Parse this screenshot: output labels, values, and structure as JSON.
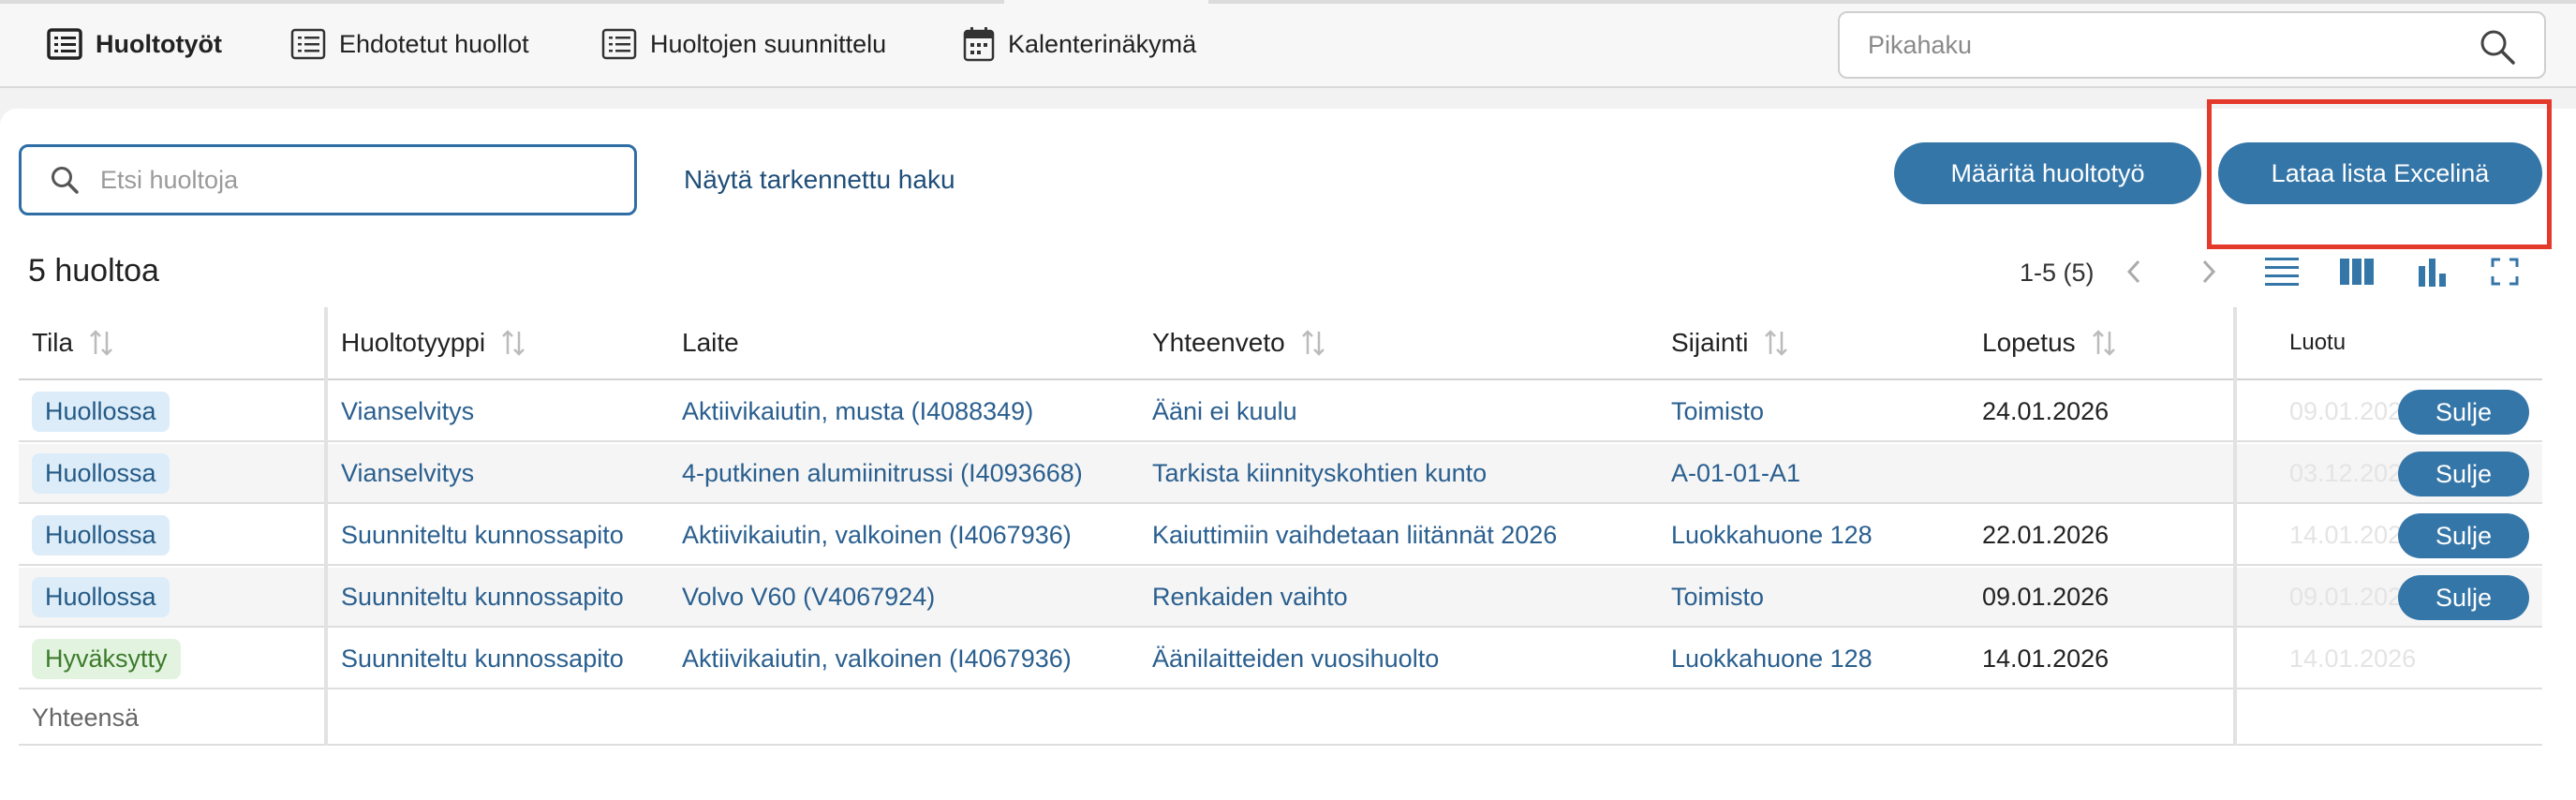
{
  "nav": {
    "items": [
      {
        "label": "Huoltotyöt",
        "icon": "list-bold-icon",
        "active": true
      },
      {
        "label": "Ehdotetut huollot",
        "icon": "list-icon",
        "active": false
      },
      {
        "label": "Huoltojen suunnittelu",
        "icon": "list-icon",
        "active": false
      },
      {
        "label": "Kalenterinäkymä",
        "icon": "calendar-icon",
        "active": false
      }
    ],
    "quick_search_placeholder": "Pikahaku"
  },
  "toolbar": {
    "search_placeholder": "Etsi huoltoja",
    "advanced_search_label": "Näytä tarkennettu haku",
    "assign_button_label": "Määritä huoltotyö",
    "excel_button_label": "Lataa lista Excelinä",
    "highlight_color": "#e43a2b"
  },
  "list": {
    "count_title": "5 huoltoa",
    "pager_text": "1-5 (5)"
  },
  "table": {
    "columns": [
      "Tila",
      "Huoltotyyppi",
      "Laite",
      "Yhteenveto",
      "Sijainti",
      "Lopetus",
      "Luotu"
    ],
    "rows": [
      {
        "status": "Huollossa",
        "type": "Vianselvitys",
        "device": "Aktiivikaiutin, musta (I4088349)",
        "summary": "Ääni ei kuulu",
        "location": "Toimisto",
        "end": "24.01.2026",
        "created": "09.01.2026",
        "action": "Sulje"
      },
      {
        "status": "Huollossa",
        "type": "Vianselvitys",
        "device": "4-putkinen alumiinitrussi (I4093668)",
        "summary": "Tarkista kiinnityskohtien kunto",
        "location": "A-01-01-A1",
        "end": "",
        "created": "03.12.2025",
        "action": "Sulje"
      },
      {
        "status": "Huollossa",
        "type": "Suunniteltu kunnossapito",
        "device": "Aktiivikaiutin, valkoinen (I4067936)",
        "summary": "Kaiuttimiin vaihdetaan liitännät 2026",
        "location": "Luokkahuone 128",
        "end": "22.01.2026",
        "created": "14.01.2026",
        "action": "Sulje"
      },
      {
        "status": "Huollossa",
        "type": "Suunniteltu kunnossapito",
        "device": "Volvo V60 (V4067924)",
        "summary": "Renkaiden vaihto",
        "location": "Toimisto",
        "end": "09.01.2026",
        "created": "09.01.2026",
        "action": "Sulje"
      },
      {
        "status": "Hyväksytty",
        "type": "Suunniteltu kunnossapito",
        "device": "Aktiivikaiutin, valkoinen (I4067936)",
        "summary": "Äänilaitteiden vuosihuolto",
        "location": "Luokkahuone 128",
        "end": "14.01.2026",
        "created": "14.01.2026",
        "action": ""
      }
    ],
    "total_label": "Yhteensä"
  },
  "colors": {
    "primary": "#3576a8",
    "link": "#2a5f8f",
    "badge_blue_bg": "#dcecf8",
    "badge_green_bg": "#e2f4df",
    "badge_green_text": "#3d7a2b"
  }
}
